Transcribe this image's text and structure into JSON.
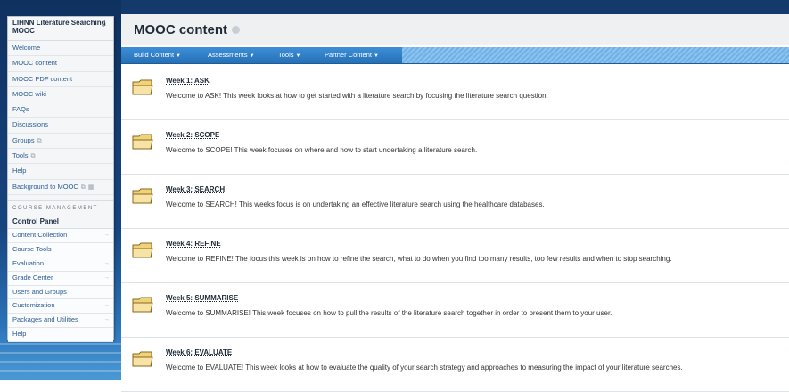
{
  "course_menu": {
    "title": "LIHNN Literature Searching MOOC",
    "items": [
      {
        "label": "Welcome"
      },
      {
        "label": "MOOC content"
      },
      {
        "label": "MOOC PDF content"
      },
      {
        "label": "MOOC wiki"
      },
      {
        "label": "FAQs"
      },
      {
        "label": "Discussions"
      },
      {
        "label": "Groups"
      },
      {
        "label": "Tools"
      },
      {
        "label": "Help"
      },
      {
        "label": "Background to MOOC"
      }
    ],
    "management_heading": "COURSE MANAGEMENT",
    "control_panel_title": "Control Panel",
    "control_items": [
      {
        "label": "Content Collection"
      },
      {
        "label": "Course Tools"
      },
      {
        "label": "Evaluation"
      },
      {
        "label": "Grade Center"
      },
      {
        "label": "Users and Groups"
      },
      {
        "label": "Customization"
      },
      {
        "label": "Packages and Utilities"
      },
      {
        "label": "Help"
      }
    ]
  },
  "page": {
    "title": "MOOC content"
  },
  "toolbar": {
    "build_content": "Build Content",
    "assessments": "Assessments",
    "tools": "Tools",
    "partner_content": "Partner Content"
  },
  "content_items": [
    {
      "title": "Week 1: ASK",
      "description": "Welcome to ASK! This week looks at how to get started with a literature search by focusing the literature search question."
    },
    {
      "title": "Week 2: SCOPE",
      "description": "Welcome to SCOPE! This week focuses on where and how to start undertaking a literature search."
    },
    {
      "title": "Week 3: SEARCH",
      "description": "Welcome to SEARCH! This weeks focus is on undertaking an effective literature search using the healthcare databases."
    },
    {
      "title": "Week 4: REFINE",
      "description": "Welcome to REFINE! The focus this week is on how to refine the search, what to do when you find too many results, too few results and when to stop searching."
    },
    {
      "title": "Week 5: SUMMARISE",
      "description": "Welcome to SUMMARISE! This week focuses on how to pull the results of the literature search together in order to present them to your user."
    },
    {
      "title": "Week 6: EVALUATE",
      "description": "Welcome to EVALUATE! This week looks at how to evaluate the quality of your search strategy and approaches to measuring the impact of your literature searches."
    }
  ],
  "icons": {
    "folder": "folder-icon",
    "home": "home-icon",
    "external": "external-link-icon",
    "chevron": "chevron-down-icon",
    "arrow": "arrow-right-icon"
  },
  "colors": {
    "toolbar": "#2e7cc6",
    "link": "#2d5d91",
    "folder": "#e8b94a"
  }
}
